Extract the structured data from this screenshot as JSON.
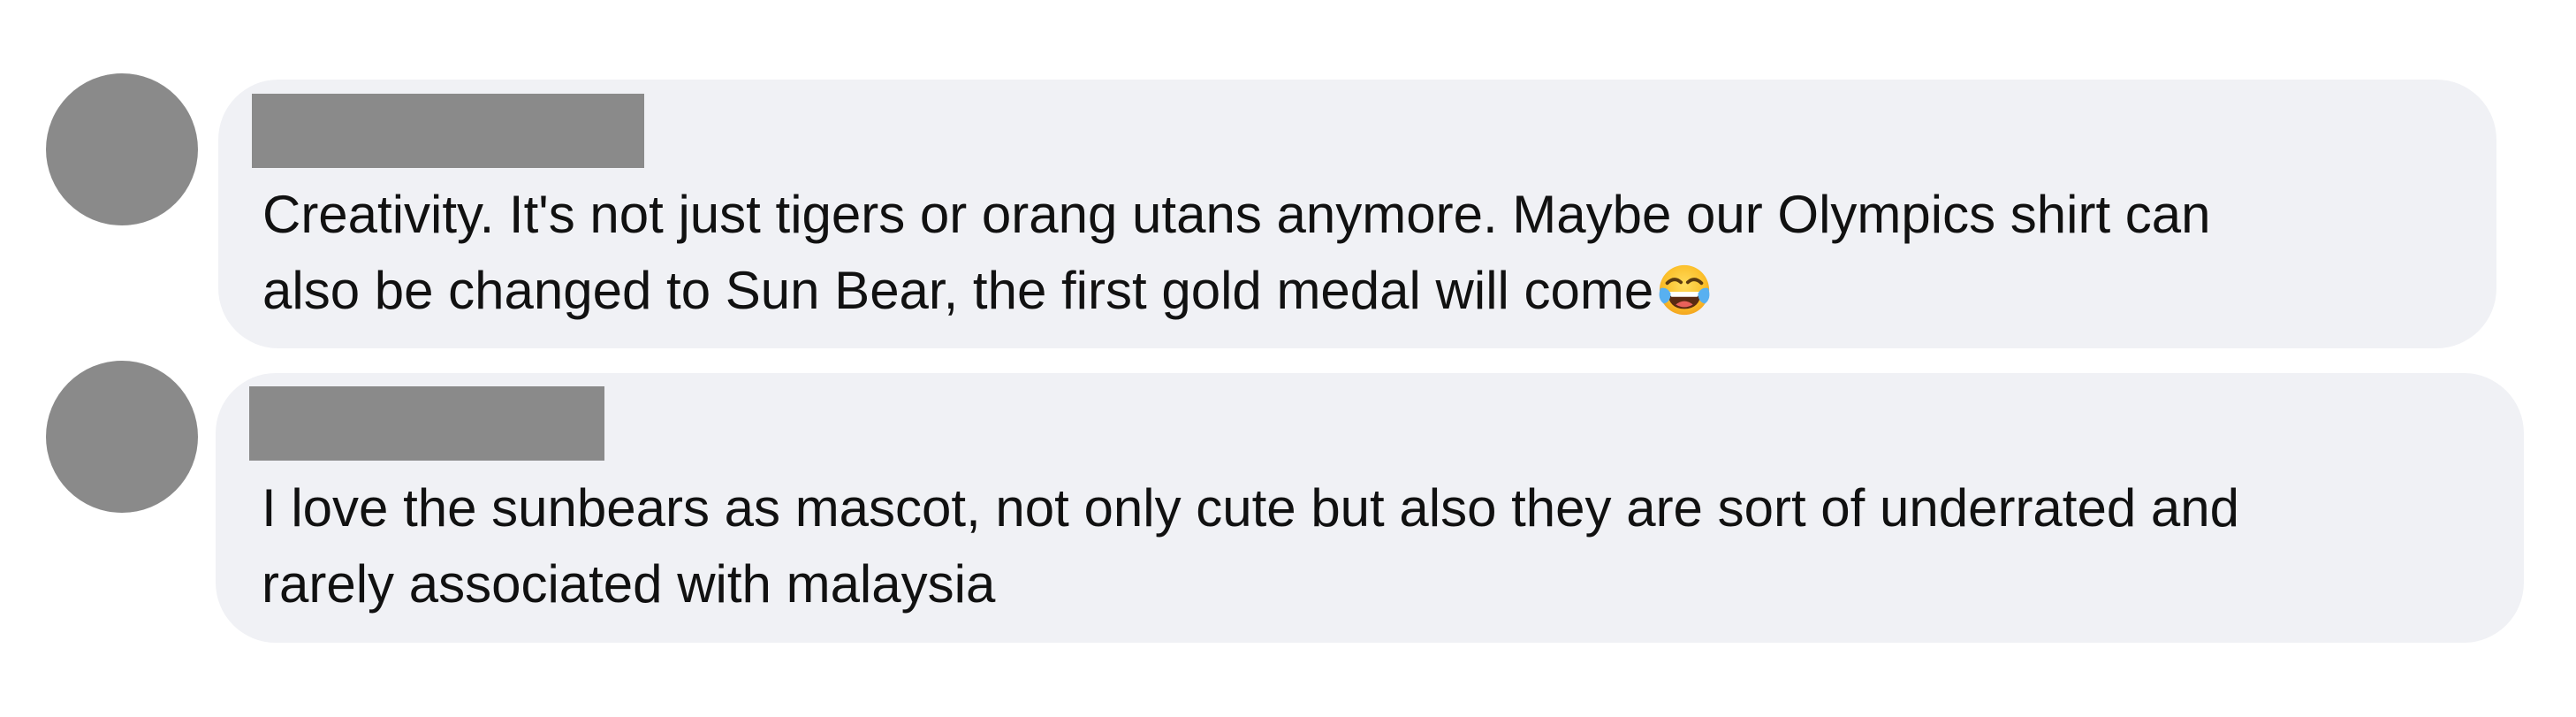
{
  "comments": [
    {
      "avatar_icon": "avatar-placeholder",
      "author_redacted": true,
      "lines": [
        "Creativity. It's not just tigers or orang utans anymore. Maybe our Olympics shirt can",
        "also be changed to Sun Bear, the first gold medal will come"
      ],
      "emoji": "face-with-tears-of-joy-icon"
    },
    {
      "avatar_icon": "avatar-placeholder",
      "author_redacted": true,
      "lines": [
        "I love the sunbears as mascot, not only cute but also they are sort of underrated and",
        "rarely associated with malaysia"
      ]
    }
  ],
  "colors": {
    "bubble_bg": "#f0f1f5",
    "redaction": "#8a8a8a",
    "text": "#111111"
  }
}
